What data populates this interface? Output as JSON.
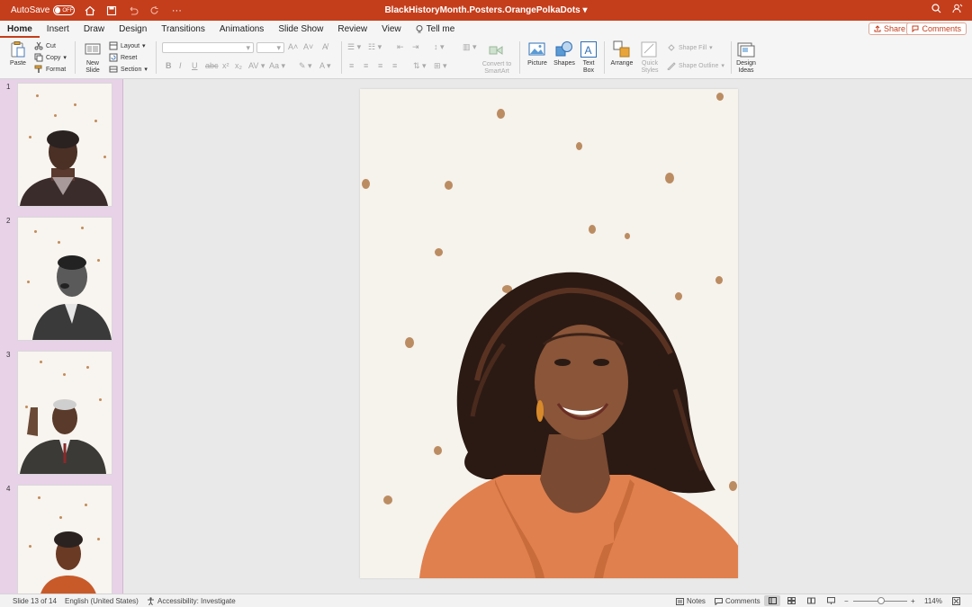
{
  "titlebar": {
    "autosave_label": "AutoSave",
    "autosave_state": "OFF",
    "document_title": "BlackHistoryMonth.Posters.OrangePolkaDots",
    "bg_color": "#c43e1c"
  },
  "tabs": [
    {
      "label": "Home",
      "active": true
    },
    {
      "label": "Insert"
    },
    {
      "label": "Draw"
    },
    {
      "label": "Design"
    },
    {
      "label": "Transitions"
    },
    {
      "label": "Animations"
    },
    {
      "label": "Slide Show"
    },
    {
      "label": "Review"
    },
    {
      "label": "View"
    }
  ],
  "tell_me": "Tell me",
  "share_label": "Share",
  "comments_label": "Comments",
  "ribbon": {
    "paste": "Paste",
    "cut": "Cut",
    "copy": "Copy",
    "format": "Format",
    "new_slide": "New Slide",
    "layout": "Layout",
    "reset": "Reset",
    "section": "Section",
    "convert_smartart": "Convert to SmartArt",
    "picture": "Picture",
    "shapes": "Shapes",
    "text_box": "Text Box",
    "arrange": "Arrange",
    "quick_styles": "Quick Styles",
    "shape_fill": "Shape Fill",
    "shape_outline": "Shape Outline",
    "design_ideas": "Design Ideas"
  },
  "thumbnails": [
    {
      "number": "1"
    },
    {
      "number": "2"
    },
    {
      "number": "3"
    },
    {
      "number": "4"
    }
  ],
  "status": {
    "slide_info": "Slide 13 of 14",
    "language": "English (United States)",
    "accessibility": "Accessibility: Investigate",
    "notes": "Notes",
    "comments": "Comments",
    "zoom": "114%"
  },
  "colors": {
    "accent": "#c43e1c",
    "slide_bg": "#f6f2ec",
    "dot": "#b07a4a",
    "sweater": "#e0804e"
  }
}
